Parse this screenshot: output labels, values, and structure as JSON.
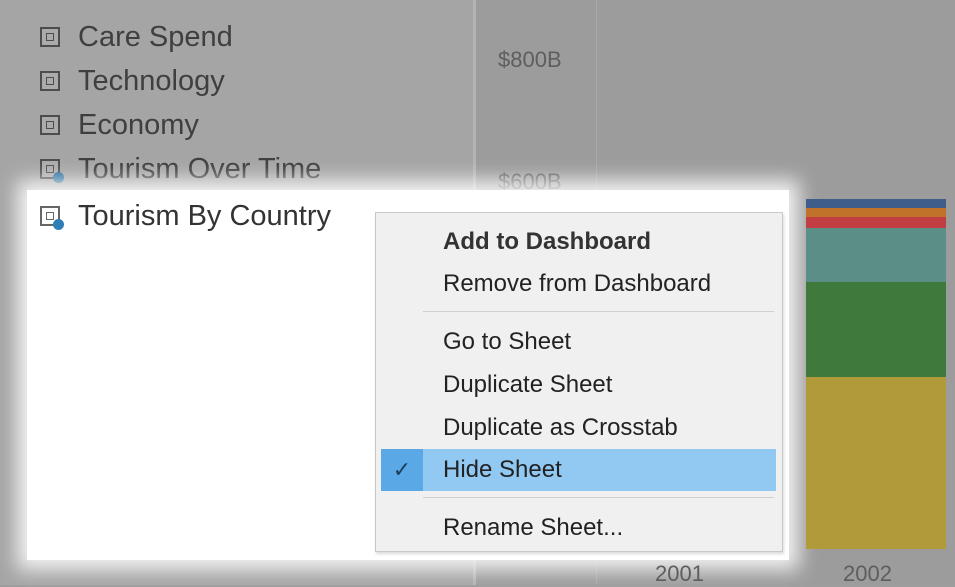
{
  "sheets": [
    {
      "label": "Care Spend"
    },
    {
      "label": "Technology"
    },
    {
      "label": "Economy"
    },
    {
      "label": "Tourism Over Time"
    },
    {
      "label": "Tourism By Country"
    }
  ],
  "chart": {
    "y_ticks": [
      "$800B",
      "$600B"
    ],
    "x_ticks": [
      "2001",
      "2002"
    ],
    "bar_colors": [
      "#3e5d8a",
      "#c0722a",
      "#c23e43",
      "#5a8e87",
      "#3f7a3c",
      "#b09a3a"
    ]
  },
  "menu": {
    "add": "Add to Dashboard",
    "remove": "Remove from Dashboard",
    "goto": "Go to Sheet",
    "duplicate": "Duplicate Sheet",
    "crosstab": "Duplicate as Crosstab",
    "hide": "Hide Sheet",
    "check": "✓",
    "rename": "Rename Sheet..."
  }
}
